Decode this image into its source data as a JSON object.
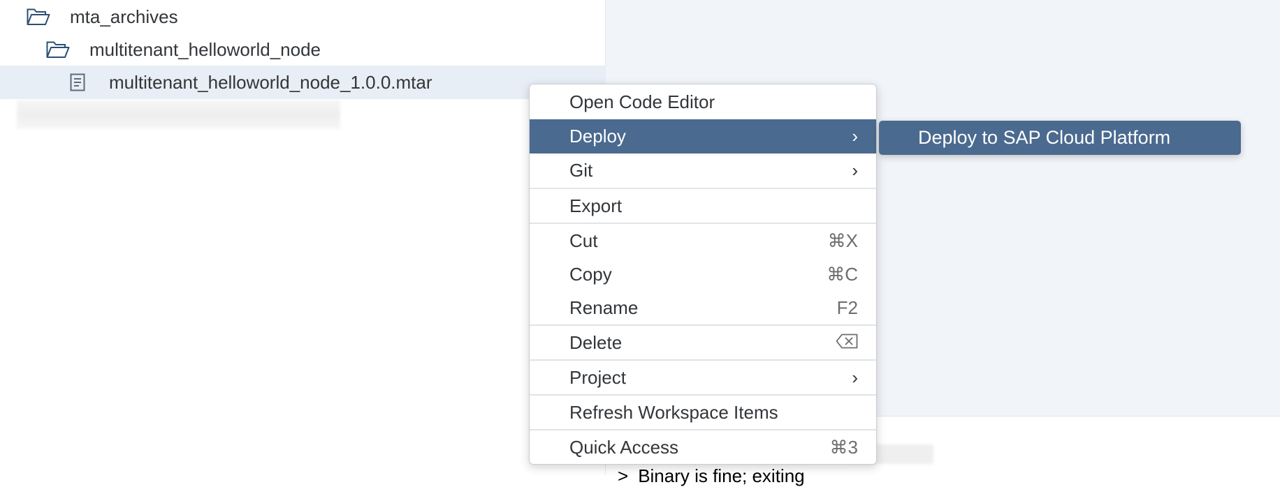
{
  "tree": {
    "items": [
      {
        "label": "mta_archives",
        "icon": "folder-open-icon"
      },
      {
        "label": "multitenant_helloworld_node",
        "icon": "folder-open-icon"
      },
      {
        "label": "multitenant_helloworld_node_1.0.0.mtar",
        "icon": "document-icon"
      }
    ]
  },
  "console": {
    "prompt": ">",
    "line": "Binary is fine; exiting"
  },
  "context_menu": {
    "open_code_editor": "Open Code Editor",
    "deploy": "Deploy",
    "git": "Git",
    "export": "Export",
    "cut": {
      "label": "Cut",
      "shortcut": "⌘X"
    },
    "copy": {
      "label": "Copy",
      "shortcut": "⌘C"
    },
    "rename": {
      "label": "Rename",
      "shortcut": "F2"
    },
    "delete": "Delete",
    "project": "Project",
    "refresh": "Refresh Workspace Items",
    "quick_access": {
      "label": "Quick Access",
      "shortcut": "⌘3"
    },
    "submenu_arrow": "›"
  },
  "submenu": {
    "deploy_to_scp": "Deploy to SAP Cloud Platform"
  },
  "colors": {
    "menu_active": "#4a6a8f",
    "tree_selected": "#e8eef5",
    "editor_bg": "#f1f4f8",
    "icon": "#2b4e73"
  }
}
